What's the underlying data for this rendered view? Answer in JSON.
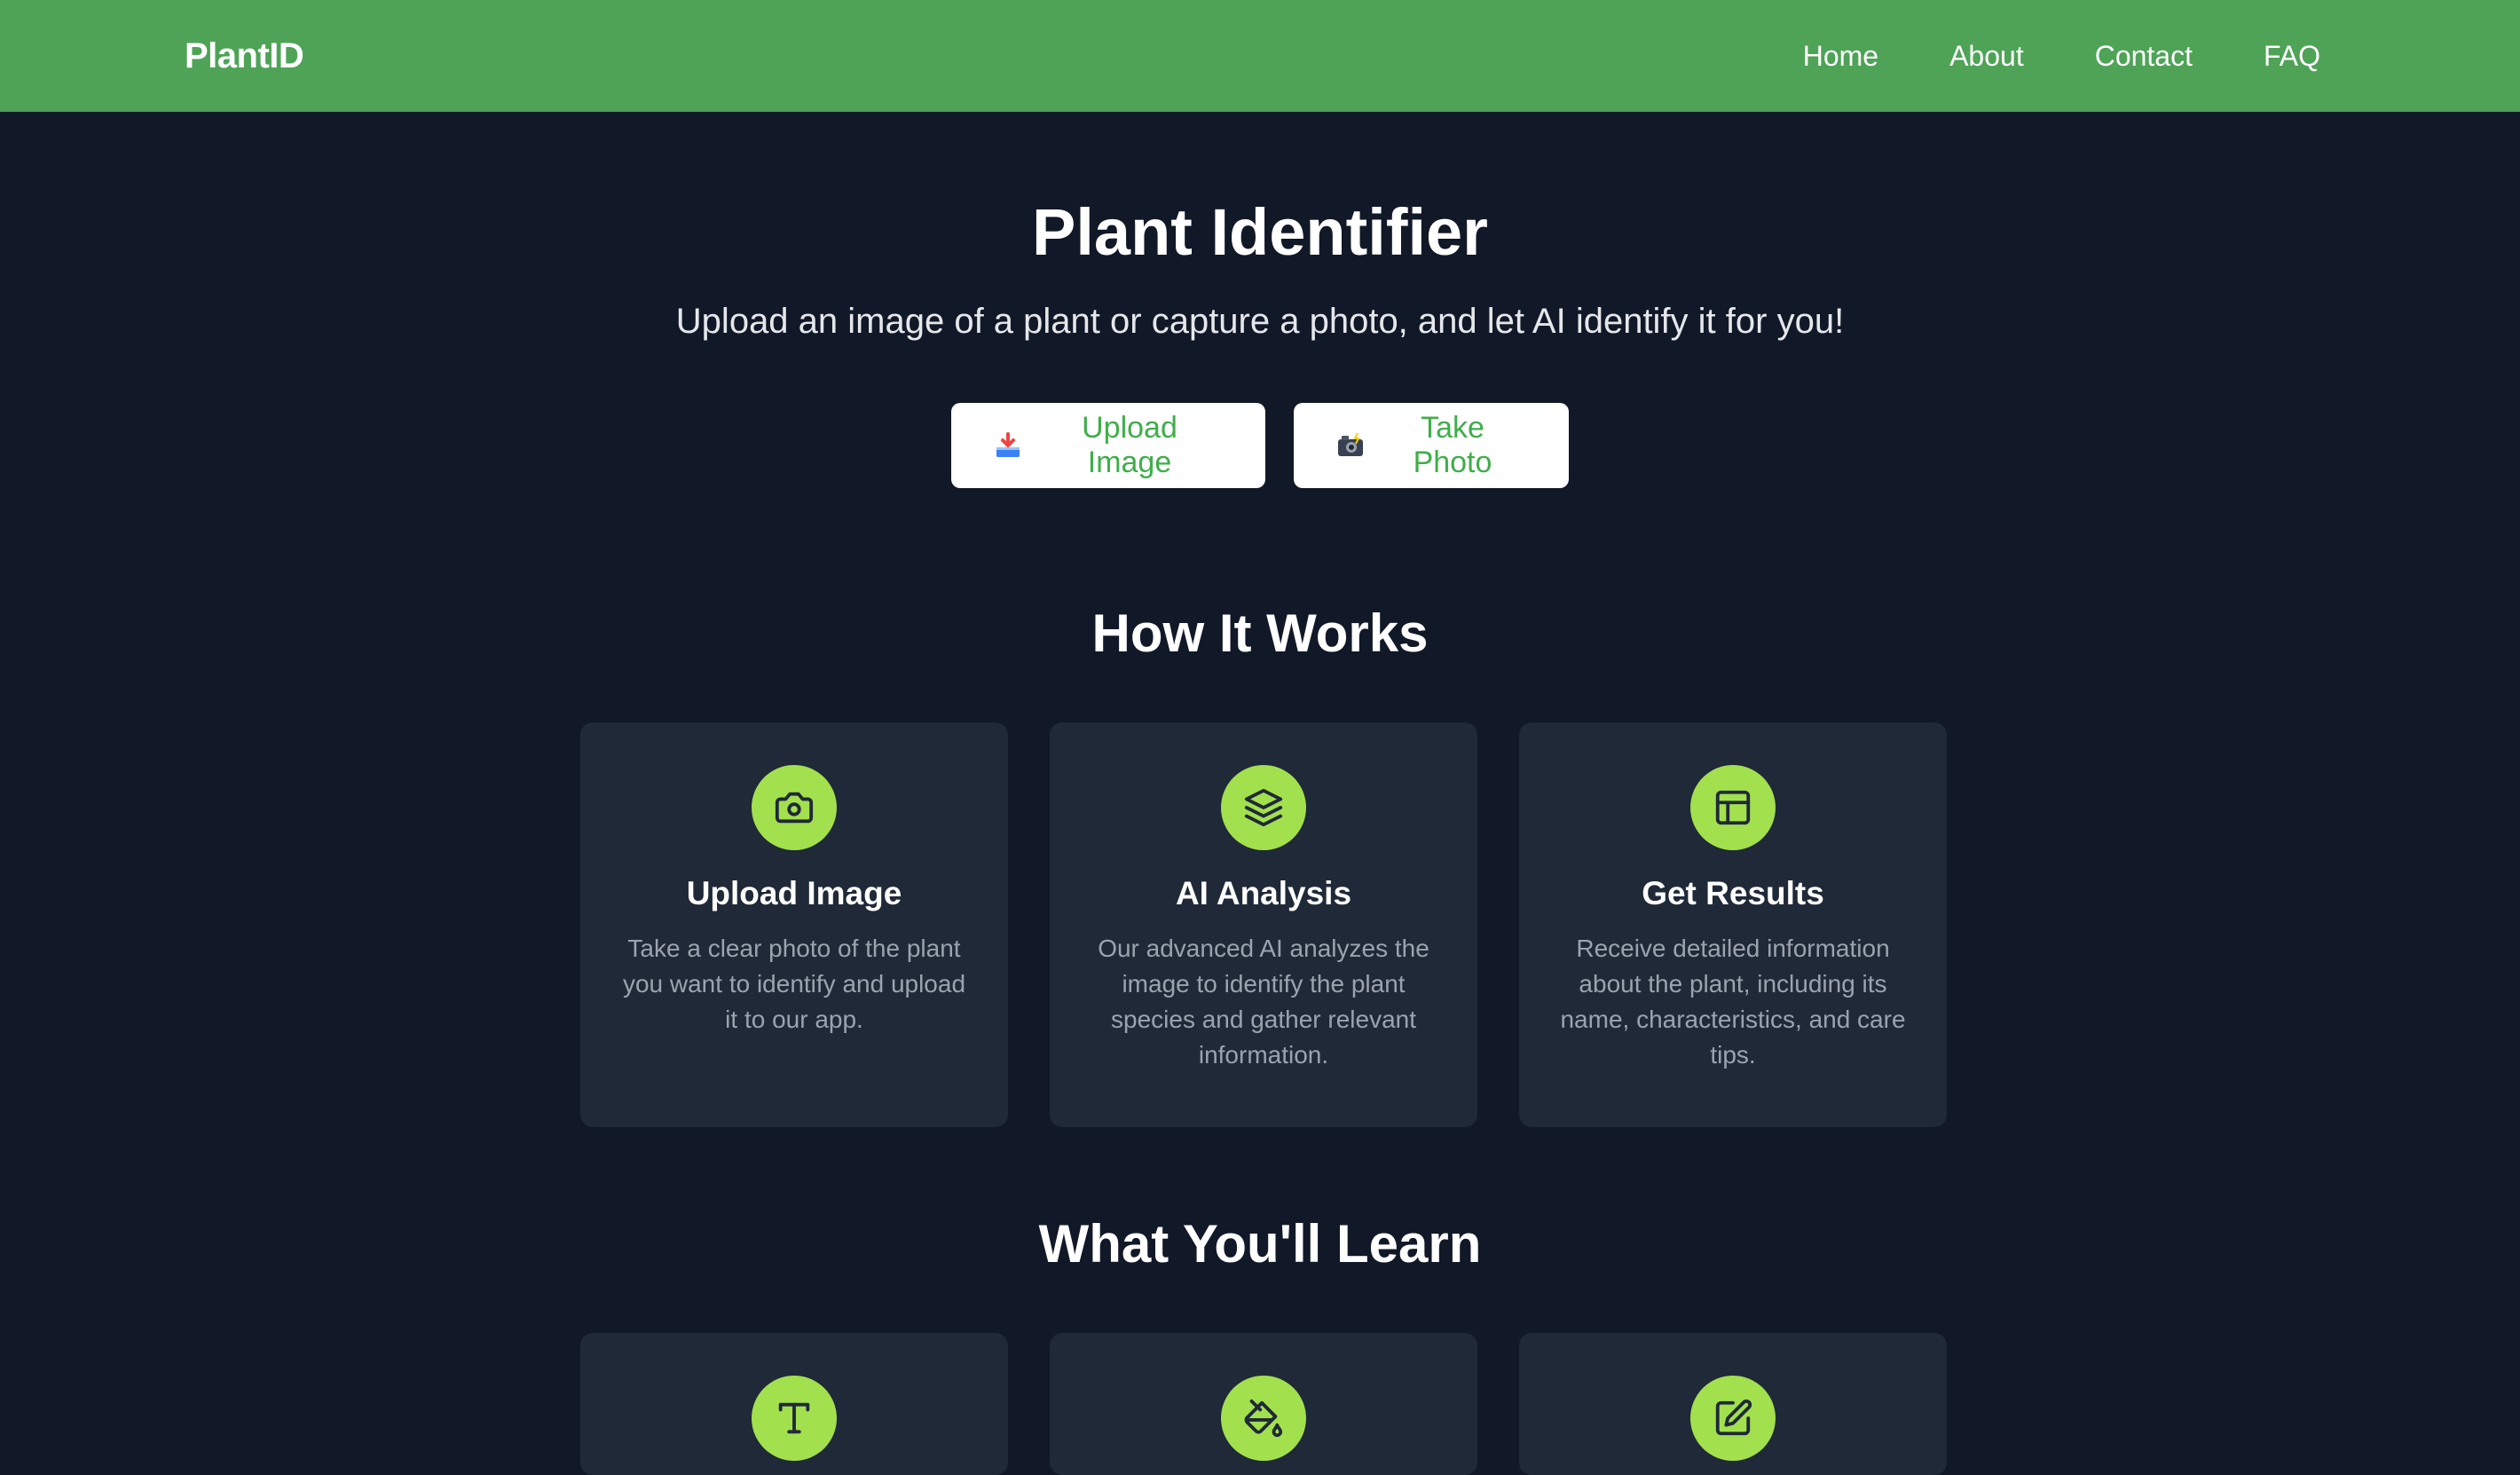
{
  "navbar": {
    "brand": "PlantID",
    "links": [
      "Home",
      "About",
      "Contact",
      "FAQ"
    ]
  },
  "hero": {
    "title": "Plant Identifier",
    "subtitle": "Upload an image of a plant or capture a photo, and let AI identify it for you!",
    "upload_button": "Upload Image",
    "photo_button": "Take Photo"
  },
  "how_it_works": {
    "title": "How It Works",
    "cards": [
      {
        "icon": "camera-icon",
        "title": "Upload Image",
        "text": "Take a clear photo of the plant you want to identify and upload it to our app."
      },
      {
        "icon": "layers-icon",
        "title": "AI Analysis",
        "text": "Our advanced AI analyzes the image to identify the plant species and gather relevant information."
      },
      {
        "icon": "layout-icon",
        "title": "Get Results",
        "text": "Receive detailed information about the plant, including its name, characteristics, and care tips."
      }
    ]
  },
  "learn": {
    "title": "What You'll Learn",
    "card_icons": [
      "type-icon",
      "paint-bucket-icon",
      "edit-icon"
    ]
  },
  "colors": {
    "nav_bg": "#4ea356",
    "page_bg": "#111827",
    "card_bg": "#1f2937",
    "icon_circle": "#a3e04e",
    "button_text": "#3fae4b"
  }
}
